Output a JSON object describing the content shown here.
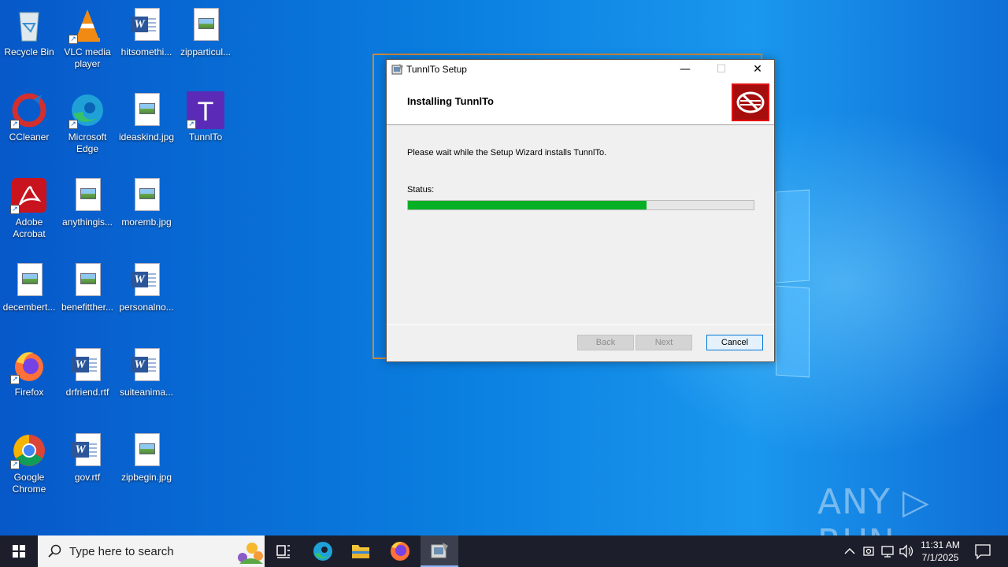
{
  "desktop": {
    "icons": [
      {
        "label": "Recycle Bin",
        "type": "recycle-bin"
      },
      {
        "label": "VLC media player",
        "type": "vlc"
      },
      {
        "label": "hitsomethi...",
        "type": "word"
      },
      {
        "label": "zipparticul...",
        "type": "image"
      },
      {
        "label": "CCleaner",
        "type": "ccleaner"
      },
      {
        "label": "Microsoft Edge",
        "type": "edge"
      },
      {
        "label": "ideaskind.jpg",
        "type": "image"
      },
      {
        "label": "TunnlTo",
        "type": "tunnlto"
      },
      {
        "label": "Adobe Acrobat",
        "type": "acrobat"
      },
      {
        "label": "anythingis...",
        "type": "image"
      },
      {
        "label": "moremb.jpg",
        "type": "image"
      },
      {
        "label": "decembert...",
        "type": "image"
      },
      {
        "label": "benefitther...",
        "type": "image"
      },
      {
        "label": "personalno...",
        "type": "word"
      },
      {
        "label": "Firefox",
        "type": "firefox"
      },
      {
        "label": "drfriend.rtf",
        "type": "word"
      },
      {
        "label": "suiteanima...",
        "type": "word"
      },
      {
        "label": "Google Chrome",
        "type": "chrome"
      },
      {
        "label": "gov.rtf",
        "type": "word"
      },
      {
        "label": "zipbegin.jpg",
        "type": "image"
      }
    ]
  },
  "window": {
    "title": "TunnlTo Setup",
    "minimize_glyph": "—",
    "maximize_glyph": "☐",
    "close_glyph": "✕",
    "heading": "Installing TunnlTo",
    "message": "Please wait while the Setup Wizard installs TunnlTo.",
    "status_label": "Status:",
    "progress": 0.69,
    "buttons": {
      "back": "Back",
      "next": "Next",
      "cancel": "Cancel"
    }
  },
  "watermark": "ANY ▷ RUN",
  "taskbar": {
    "search_placeholder": "Type here to search",
    "apps": [
      "task-view",
      "edge",
      "file-explorer",
      "firefox",
      "setup"
    ],
    "clock_time": "11:31 AM",
    "clock_date": "7/1/2025"
  },
  "colors": {
    "progress_fill": "#06b025",
    "accent": "#0078d7",
    "taskbar": "#1c1f2b"
  }
}
